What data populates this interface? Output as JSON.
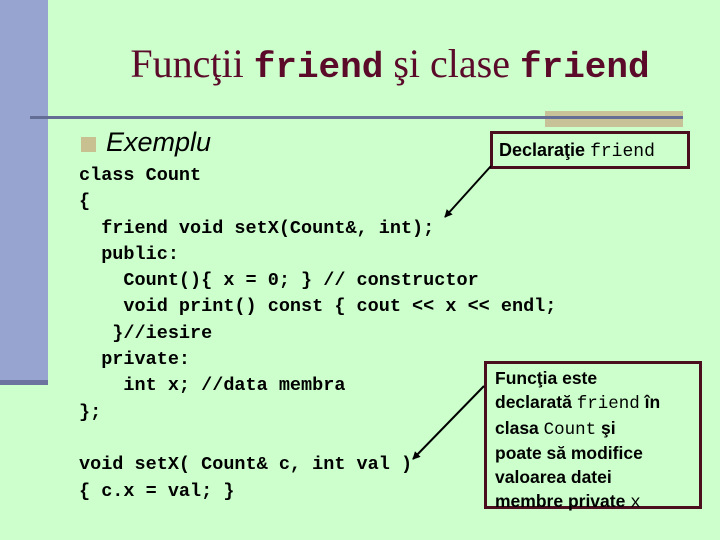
{
  "slide": {
    "title": {
      "part1": "Funcţii ",
      "kw1": "friend",
      "part2": " şi clase ",
      "kw2": "friend"
    },
    "bullet": "Exemplu",
    "code_lines": [
      "class Count",
      "{",
      "  friend void setX(Count&, int);",
      "  public:",
      "    Count(){ x = 0; } // constructor",
      "    void print() const { cout << x << endl;",
      "   }//iesire",
      "  private:",
      "    int x; //data membra",
      "};",
      "",
      "void setX( Count& c, int val )",
      "{ c.x = val; }"
    ],
    "callout_declaration": {
      "text": "Declaraţie ",
      "kw": "friend"
    },
    "callout_explanation": {
      "line1": "Funcţia este",
      "line2_a": "declarată ",
      "line2_kw": "friend",
      "line2_b": " în",
      "line3_a": "clasa ",
      "line3_kw": "Count",
      "line3_b": " şi",
      "line4": "poate să modifice",
      "line5": "valoarea datei",
      "line6_a": "membre private ",
      "line6_kw": "x"
    }
  },
  "colors": {
    "background": "#ccffcc",
    "sidebar": "#97a4cf",
    "title": "#5c0a2a",
    "callout_border": "#4a0e1e",
    "accent": "#c8c298"
  }
}
